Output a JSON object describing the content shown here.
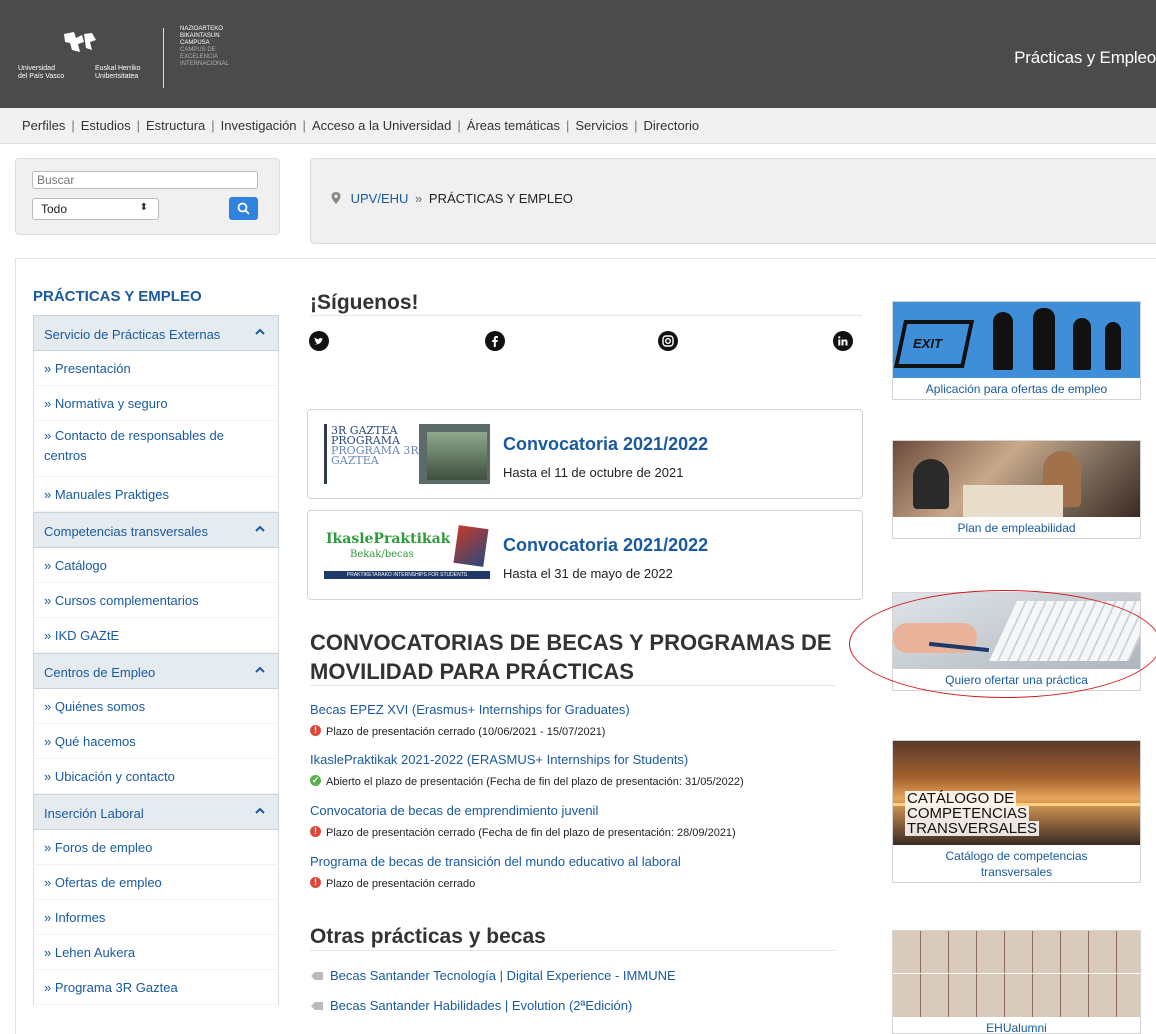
{
  "header": {
    "logo_left": [
      "Universidad",
      "del País Vasco"
    ],
    "logo_right": [
      "Euskal Herriko",
      "Unibertsitatea"
    ],
    "campus_bright": [
      "NAZIOARTEKO",
      "BIKAINTASUN",
      "CAMPUSA"
    ],
    "campus_dim": [
      "CAMPUS DE",
      "EXCELENCIA",
      "INTERNACIONAL"
    ],
    "title": "Prácticas y Empleo"
  },
  "topnav": {
    "items": [
      "Perfiles",
      "Estudios",
      "Estructura",
      "Investigación",
      "Acceso a la Universidad",
      "Áreas temáticas",
      "Servicios",
      "Directorio"
    ]
  },
  "search": {
    "placeholder": "Buscar",
    "scope_selected": "Todo"
  },
  "breadcrumb": {
    "home": "UPV/EHU",
    "separator": "»",
    "current": "PRÁCTICAS Y EMPLEO"
  },
  "sidebar": {
    "title": "PRÁCTICAS Y EMPLEO",
    "sections": [
      {
        "label": "Servicio de Prácticas Externas",
        "items": [
          "» Presentación",
          "» Normativa y seguro",
          "» Contacto de responsables de centros",
          "» Manuales Praktiges"
        ]
      },
      {
        "label": "Competencias transversales",
        "items": [
          "» Catálogo",
          "» Cursos complementarios",
          "» IKD GAZtE"
        ]
      },
      {
        "label": "Centros de Empleo",
        "items": [
          "» Quiénes somos",
          "» Qué hacemos",
          "» Ubicación y contacto"
        ]
      },
      {
        "label": "Inserción Laboral",
        "items": [
          "» Foros de empleo",
          "» Ofertas de empleo",
          "» Informes",
          "» Lehen Aukera",
          "» Programa 3R Gaztea"
        ]
      }
    ]
  },
  "follow": {
    "title": "¡Síguenos!",
    "icons": [
      "twitter-icon",
      "facebook-icon",
      "instagram-icon",
      "linkedin-icon"
    ]
  },
  "cards": [
    {
      "thumb_lines": [
        "3R GAZTEA",
        "PROGRAMA",
        "PROGRAMA 3R",
        "GAZTEA"
      ],
      "title": "Convocatoria 2021/2022",
      "subtitle": "Hasta el 11 de octubre de 2021"
    },
    {
      "thumb_lines": [
        "IkaslePraktikak",
        "Bekak/becas",
        "PRAKTIKETARAKO INTERNSHIPS FOR STUDENTS"
      ],
      "title": "Convocatoria 2021/2022",
      "subtitle": "Hasta el 31 de mayo de 2022"
    }
  ],
  "convocatorias": {
    "title": "CONVOCATORIAS DE BECAS Y PROGRAMAS DE MOVILIDAD PARA PRÁCTICAS",
    "items": [
      {
        "link": "Becas EPEZ XVI (Erasmus+ Internships for Graduates)",
        "status": "Plazo de presentación cerrado (10/06/2021 - 15/07/2021)",
        "state": "closed"
      },
      {
        "link": "IkaslePraktikak 2021-2022 (ERASMUS+ Internships for Students)",
        "status": "Abierto el plazo de presentación (Fecha de fin del plazo de presentación: 31/05/2022)",
        "state": "open"
      },
      {
        "link": "Convocatoria de becas de emprendimiento juvenil",
        "status": "Plazo de presentación cerrado (Fecha de fin del plazo de presentación: 28/09/2021)",
        "state": "closed"
      },
      {
        "link": "Programa de becas de transición del mundo educativo al laboral",
        "status": "Plazo de presentación cerrado",
        "state": "closed"
      }
    ]
  },
  "otras": {
    "title": "Otras prácticas y becas",
    "items": [
      "Becas Santander Tecnología | Digital Experience - IMMUNE",
      "Becas Santander Habilidades | Evolution (2ªEdición)"
    ]
  },
  "right_cards": [
    {
      "caption": "Aplicación para ofertas de empleo",
      "image_text": "EXIT"
    },
    {
      "caption": "Plan de empleabilidad"
    },
    {
      "caption": "Quiero ofertar una práctica"
    },
    {
      "caption": "Catálogo de competencias transversales",
      "image_text": [
        "CATÁLOGO DE",
        "COMPETENCIAS",
        "TRANSVERSALES"
      ]
    },
    {
      "caption": "EHUalumni"
    }
  ],
  "colors": {
    "header_bg": "#4b4b4b",
    "link": "#1a5aa0",
    "closed": "#e0473a",
    "open": "#58b14d",
    "annotation": "#d0191e"
  }
}
